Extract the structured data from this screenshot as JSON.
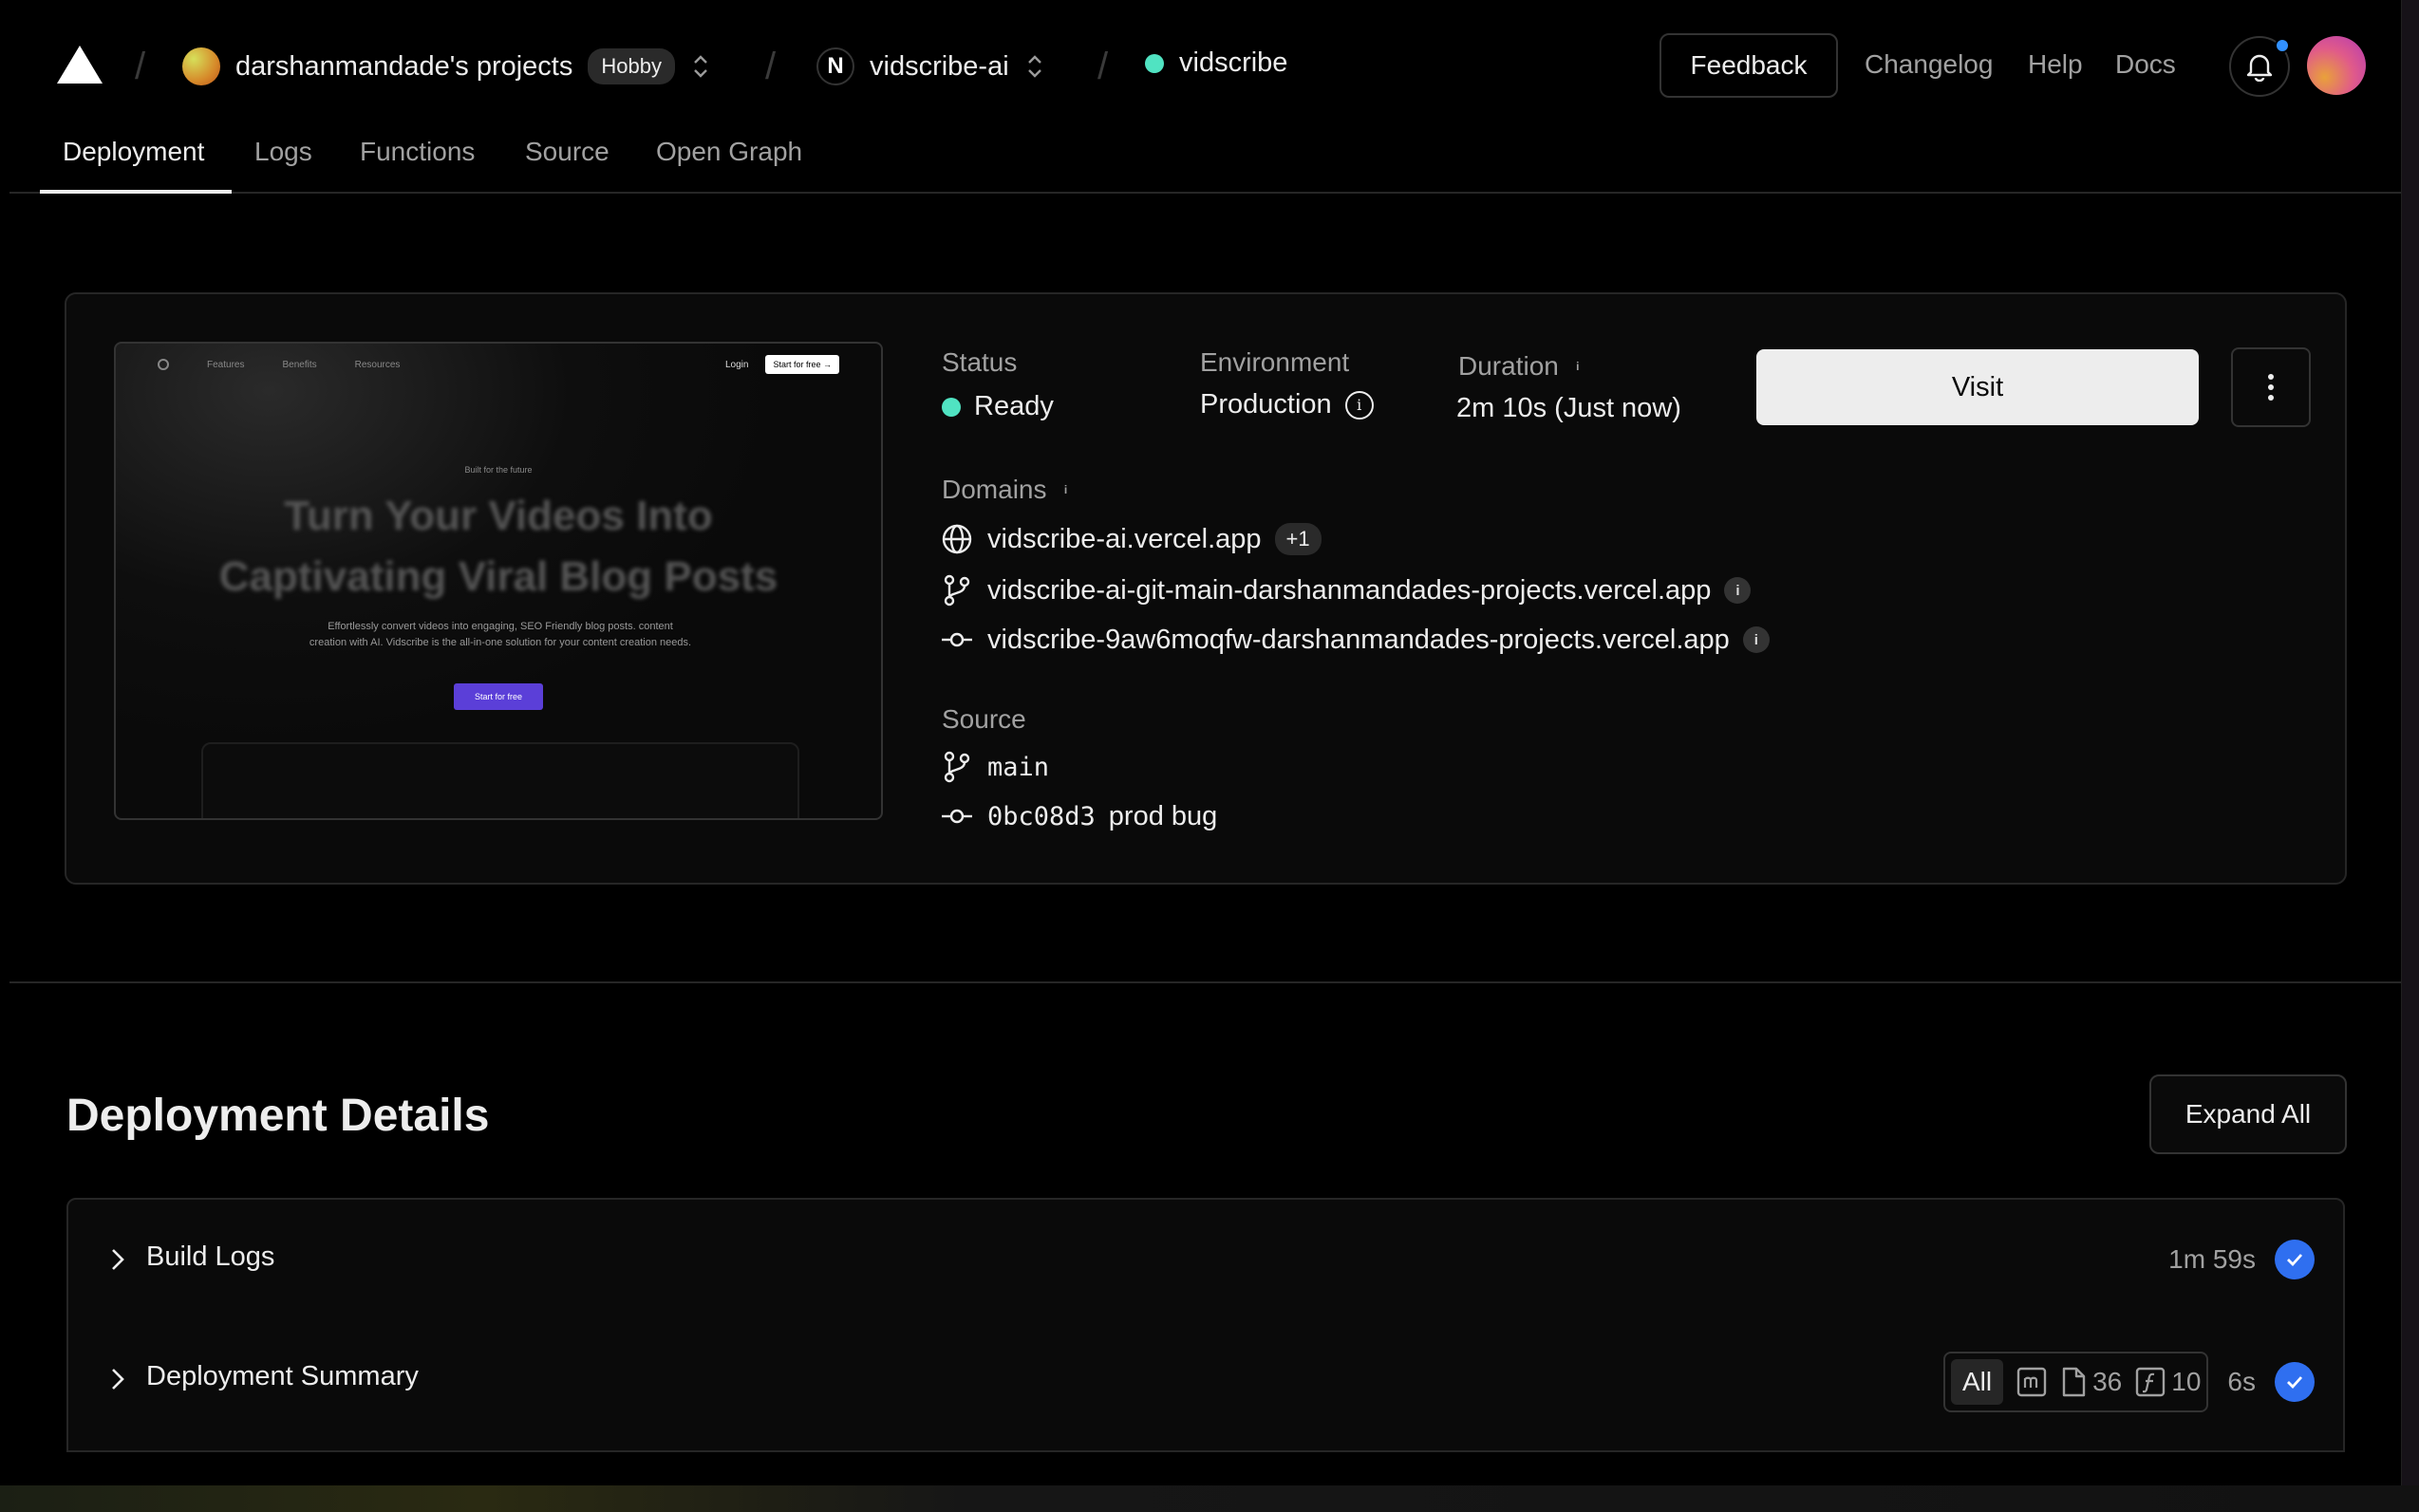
{
  "header": {
    "team_name": "darshanmandade's projects",
    "plan_badge": "Hobby",
    "project_name": "vidscribe-ai",
    "project_icon_letter": "N",
    "deployment_name": "vidscribe",
    "feedback_label": "Feedback",
    "changelog_label": "Changelog",
    "help_label": "Help",
    "docs_label": "Docs"
  },
  "tabs": [
    {
      "label": "Deployment",
      "active": true
    },
    {
      "label": "Logs"
    },
    {
      "label": "Functions"
    },
    {
      "label": "Source"
    },
    {
      "label": "Open Graph"
    }
  ],
  "preview": {
    "nav_links": [
      "Features",
      "Benefits",
      "Resources"
    ],
    "login": "Login",
    "cta": "Start for free →",
    "pill": "Built for the future",
    "headline_1": "Turn Your Videos Into",
    "headline_2": "Captivating Viral Blog Posts",
    "subtext_1": "Effortlessly convert videos into engaging, SEO Friendly blog posts. content",
    "subtext_2": "creation with AI. Vidscribe is the all-in-one solution for your content creation needs.",
    "button": "Start for free"
  },
  "deployment": {
    "status_label": "Status",
    "status_value": "Ready",
    "environment_label": "Environment",
    "environment_value": "Production",
    "duration_label": "Duration",
    "duration_value": "2m 10s (Just now)",
    "visit_label": "Visit",
    "domains_label": "Domains",
    "domains": [
      {
        "url": "vidscribe-ai.vercel.app",
        "extra": "+1",
        "icon": "globe-icon"
      },
      {
        "url": "vidscribe-ai-git-main-darshanmandades-projects.vercel.app",
        "icon": "git-branch-icon"
      },
      {
        "url": "vidscribe-9aw6moqfw-darshanmandades-projects.vercel.app",
        "icon": "git-commit-icon"
      }
    ],
    "source_label": "Source",
    "branch": "main",
    "commit_hash": "0bc08d3",
    "commit_message": "prod bug"
  },
  "details": {
    "title": "Deployment Details",
    "expand_all_label": "Expand All",
    "sections": [
      {
        "title": "Build Logs",
        "duration": "1m 59s"
      },
      {
        "title": "Deployment Summary",
        "duration": "6s",
        "filter_all": "All",
        "static_count": "36",
        "function_count": "10"
      }
    ]
  },
  "colors": {
    "ready": "#50e3c2",
    "accent_blue": "#2f6ff0",
    "notification_dot": "#3291ff"
  }
}
